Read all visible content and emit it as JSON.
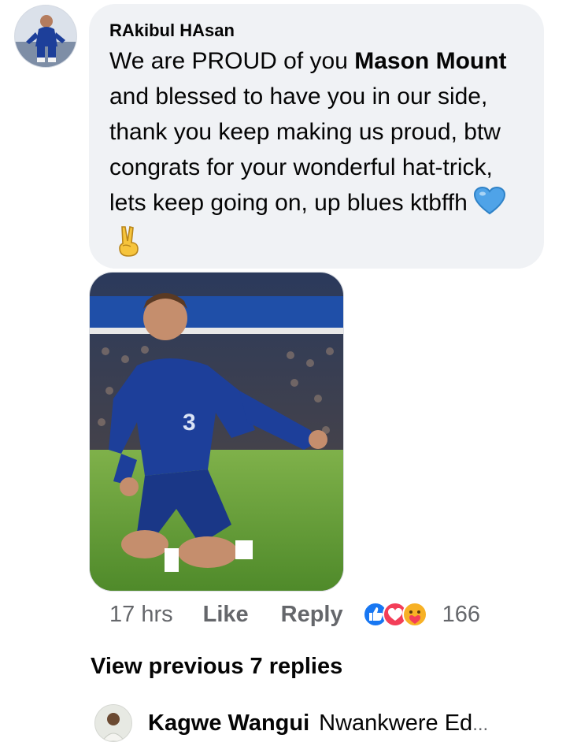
{
  "comment": {
    "author": "RAkibul HAsan",
    "text_before": "We are PROUD of you ",
    "bold_name": "Mason Mount",
    "text_after": " and blessed to have you in our side, thank you keep making us proud, btw congrats for your wonderful hat-trick, lets keep going on, up blues ktbffh",
    "emoji_1": "blue-heart-icon",
    "emoji_2": "victory-hand-icon"
  },
  "actions": {
    "time": "17 hrs",
    "like_label": "Like",
    "reply_label": "Reply",
    "reaction_icons": [
      "like-reaction-icon",
      "love-reaction-icon",
      "care-reaction-icon"
    ],
    "reaction_count": "166"
  },
  "view_previous": "View previous 7 replies",
  "reply_preview": {
    "author": "Kagwe Wangui",
    "text": "Nwankwere Ed",
    "ellipsis": "..."
  },
  "colors": {
    "bubble": "#f0f2f5",
    "secondary_text": "#65676b",
    "like_blue": "#1877f2",
    "love_red": "#f33e58",
    "care_yellow": "#f7b125",
    "chelsea_blue": "#1d3f9a"
  }
}
